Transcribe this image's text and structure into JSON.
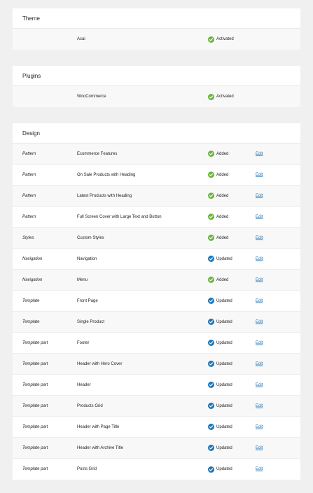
{
  "theme": {
    "heading": "Theme",
    "rows": [
      {
        "type": "",
        "name": "Acai",
        "status": "Activated",
        "status_kind": "added"
      }
    ]
  },
  "plugins": {
    "heading": "Plugins",
    "rows": [
      {
        "type": "",
        "name": "WooCommerce",
        "status": "Activated",
        "status_kind": "added"
      }
    ]
  },
  "design": {
    "heading": "Design",
    "edit_label": "Edit",
    "rows": [
      {
        "type": "Pattern",
        "name": "Ecommerce Features",
        "status": "Added",
        "status_kind": "added"
      },
      {
        "type": "Pattern",
        "name": "On Sale Products with Heading",
        "status": "Added",
        "status_kind": "added"
      },
      {
        "type": "Pattern",
        "name": "Latest Products with Heading",
        "status": "Added",
        "status_kind": "added"
      },
      {
        "type": "Pattern",
        "name": "Full Screen Cover with Large Text and Button",
        "status": "Added",
        "status_kind": "added"
      },
      {
        "type": "Styles",
        "name": "Custom Styles",
        "status": "Added",
        "status_kind": "added"
      },
      {
        "type": "Navigation",
        "name": "Navigation",
        "status": "Updated",
        "status_kind": "updated"
      },
      {
        "type": "Navigation",
        "name": "Menu",
        "status": "Added",
        "status_kind": "added"
      },
      {
        "type": "Template",
        "name": "Front Page",
        "status": "Updated",
        "status_kind": "updated"
      },
      {
        "type": "Template",
        "name": "Single Product",
        "status": "Updated",
        "status_kind": "updated"
      },
      {
        "type": "Template part",
        "name": "Footer",
        "status": "Updated",
        "status_kind": "updated"
      },
      {
        "type": "Template part",
        "name": "Header with Hero Cover",
        "status": "Updated",
        "status_kind": "updated"
      },
      {
        "type": "Template part",
        "name": "Header",
        "status": "Updated",
        "status_kind": "updated"
      },
      {
        "type": "Template part",
        "name": "Products Grid",
        "status": "Updated",
        "status_kind": "updated"
      },
      {
        "type": "Template part",
        "name": "Header with Page Title",
        "status": "Updated",
        "status_kind": "updated"
      },
      {
        "type": "Template part",
        "name": "Header with Archive Title",
        "status": "Updated",
        "status_kind": "updated"
      },
      {
        "type": "Template part",
        "name": "Posts Grid",
        "status": "Updated",
        "status_kind": "updated"
      }
    ]
  },
  "colors": {
    "added": "#68b538",
    "updated": "#1a76b8",
    "link": "#2271b1"
  },
  "icons": {
    "added": "check-circle-green-icon",
    "updated": "check-circle-blue-icon"
  }
}
